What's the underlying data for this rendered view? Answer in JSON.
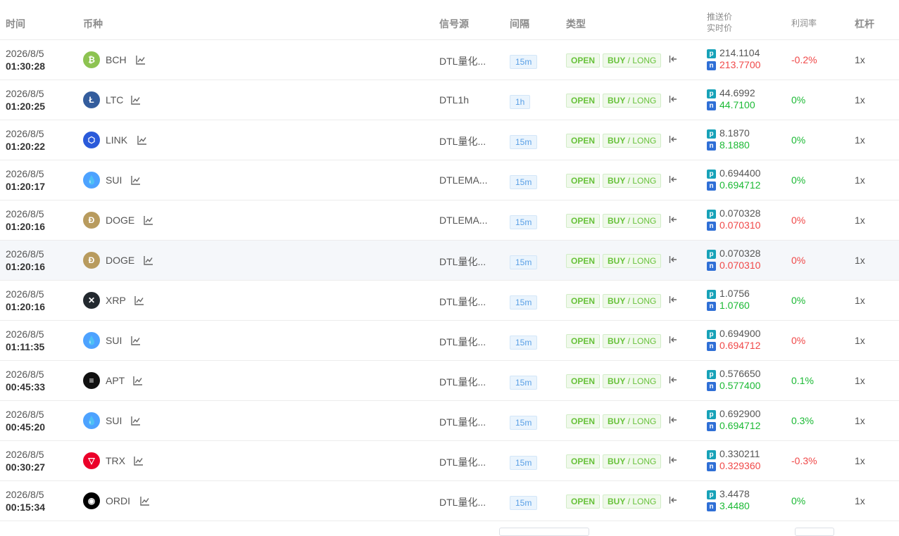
{
  "header": {
    "time": "时间",
    "coin": "币种",
    "source": "信号源",
    "interval": "间隔",
    "type": "类型",
    "push_price": "推送价",
    "real_price": "实时价",
    "profit": "利润率",
    "leverage": "杠杆"
  },
  "rows": [
    {
      "date": "2026/8/5",
      "time": "01:30:28",
      "coin": "BCH",
      "icon": "bitcoin-cash-icon",
      "color": "#8dc351",
      "glyph": "₿",
      "source": "DTL量化...",
      "interval": "15m",
      "status": "OPEN",
      "side": "BUY",
      "dir": "LONG",
      "push": "214.1104",
      "real": "213.7700",
      "real_color": "red",
      "profit": "-0.2%",
      "profit_color": "red",
      "lev": "1x"
    },
    {
      "date": "2026/8/5",
      "time": "01:20:25",
      "coin": "LTC",
      "icon": "litecoin-icon",
      "color": "#345d9d",
      "glyph": "Ł",
      "source": "DTL1h",
      "interval": "1h",
      "status": "OPEN",
      "side": "BUY",
      "dir": "LONG",
      "push": "44.6992",
      "real": "44.7100",
      "real_color": "green",
      "profit": "0%",
      "profit_color": "green",
      "lev": "1x"
    },
    {
      "date": "2026/8/5",
      "time": "01:20:22",
      "coin": "LINK",
      "icon": "chainlink-icon",
      "color": "#2a5ada",
      "glyph": "⬡",
      "source": "DTL量化...",
      "interval": "15m",
      "status": "OPEN",
      "side": "BUY",
      "dir": "LONG",
      "push": "8.1870",
      "real": "8.1880",
      "real_color": "green",
      "profit": "0%",
      "profit_color": "green",
      "lev": "1x"
    },
    {
      "date": "2026/8/5",
      "time": "01:20:17",
      "coin": "SUI",
      "icon": "sui-icon",
      "color": "#4da2ff",
      "glyph": "💧",
      "source": "DTLEMA...",
      "interval": "15m",
      "status": "OPEN",
      "side": "BUY",
      "dir": "LONG",
      "push": "0.694400",
      "real": "0.694712",
      "real_color": "green",
      "profit": "0%",
      "profit_color": "green",
      "lev": "1x"
    },
    {
      "date": "2026/8/5",
      "time": "01:20:16",
      "coin": "DOGE",
      "icon": "dogecoin-icon",
      "color": "#b89b5e",
      "glyph": "Ð",
      "source": "DTLEMA...",
      "interval": "15m",
      "status": "OPEN",
      "side": "BUY",
      "dir": "LONG",
      "push": "0.070328",
      "real": "0.070310",
      "real_color": "red",
      "profit": "0%",
      "profit_color": "red",
      "lev": "1x"
    },
    {
      "date": "2026/8/5",
      "time": "01:20:16",
      "coin": "DOGE",
      "icon": "dogecoin-icon",
      "color": "#b89b5e",
      "glyph": "Ð",
      "source": "DTL量化...",
      "interval": "15m",
      "status": "OPEN",
      "side": "BUY",
      "dir": "LONG",
      "push": "0.070328",
      "real": "0.070310",
      "real_color": "red",
      "profit": "0%",
      "profit_color": "red",
      "lev": "1x",
      "highlight": true
    },
    {
      "date": "2026/8/5",
      "time": "01:20:16",
      "coin": "XRP",
      "icon": "xrp-icon",
      "color": "#23292f",
      "glyph": "✕",
      "source": "DTL量化...",
      "interval": "15m",
      "status": "OPEN",
      "side": "BUY",
      "dir": "LONG",
      "push": "1.0756",
      "real": "1.0760",
      "real_color": "green",
      "profit": "0%",
      "profit_color": "green",
      "lev": "1x"
    },
    {
      "date": "2026/8/5",
      "time": "01:11:35",
      "coin": "SUI",
      "icon": "sui-icon",
      "color": "#4da2ff",
      "glyph": "💧",
      "source": "DTL量化...",
      "interval": "15m",
      "status": "OPEN",
      "side": "BUY",
      "dir": "LONG",
      "push": "0.694900",
      "real": "0.694712",
      "real_color": "red",
      "profit": "0%",
      "profit_color": "red",
      "lev": "1x"
    },
    {
      "date": "2026/8/5",
      "time": "00:45:33",
      "coin": "APT",
      "icon": "aptos-icon",
      "color": "#111111",
      "glyph": "≡",
      "source": "DTL量化...",
      "interval": "15m",
      "status": "OPEN",
      "side": "BUY",
      "dir": "LONG",
      "push": "0.576650",
      "real": "0.577400",
      "real_color": "green",
      "profit": "0.1%",
      "profit_color": "green",
      "lev": "1x"
    },
    {
      "date": "2026/8/5",
      "time": "00:45:20",
      "coin": "SUI",
      "icon": "sui-icon",
      "color": "#4da2ff",
      "glyph": "💧",
      "source": "DTL量化...",
      "interval": "15m",
      "status": "OPEN",
      "side": "BUY",
      "dir": "LONG",
      "push": "0.692900",
      "real": "0.694712",
      "real_color": "green",
      "profit": "0.3%",
      "profit_color": "green",
      "lev": "1x"
    },
    {
      "date": "2026/8/5",
      "time": "00:30:27",
      "coin": "TRX",
      "icon": "tron-icon",
      "color": "#eb0029",
      "glyph": "▽",
      "source": "DTL量化...",
      "interval": "15m",
      "status": "OPEN",
      "side": "BUY",
      "dir": "LONG",
      "push": "0.330211",
      "real": "0.329360",
      "real_color": "red",
      "profit": "-0.3%",
      "profit_color": "red",
      "lev": "1x"
    },
    {
      "date": "2026/8/5",
      "time": "00:15:34",
      "coin": "ORDI",
      "icon": "ordi-icon",
      "color": "#000000",
      "glyph": "◉",
      "source": "DTL量化...",
      "interval": "15m",
      "status": "OPEN",
      "side": "BUY",
      "dir": "LONG",
      "push": "3.4478",
      "real": "3.4480",
      "real_color": "green",
      "profit": "0%",
      "profit_color": "green",
      "lev": "1x"
    }
  ],
  "badges": {
    "push_letter": "p",
    "real_letter": "n"
  }
}
